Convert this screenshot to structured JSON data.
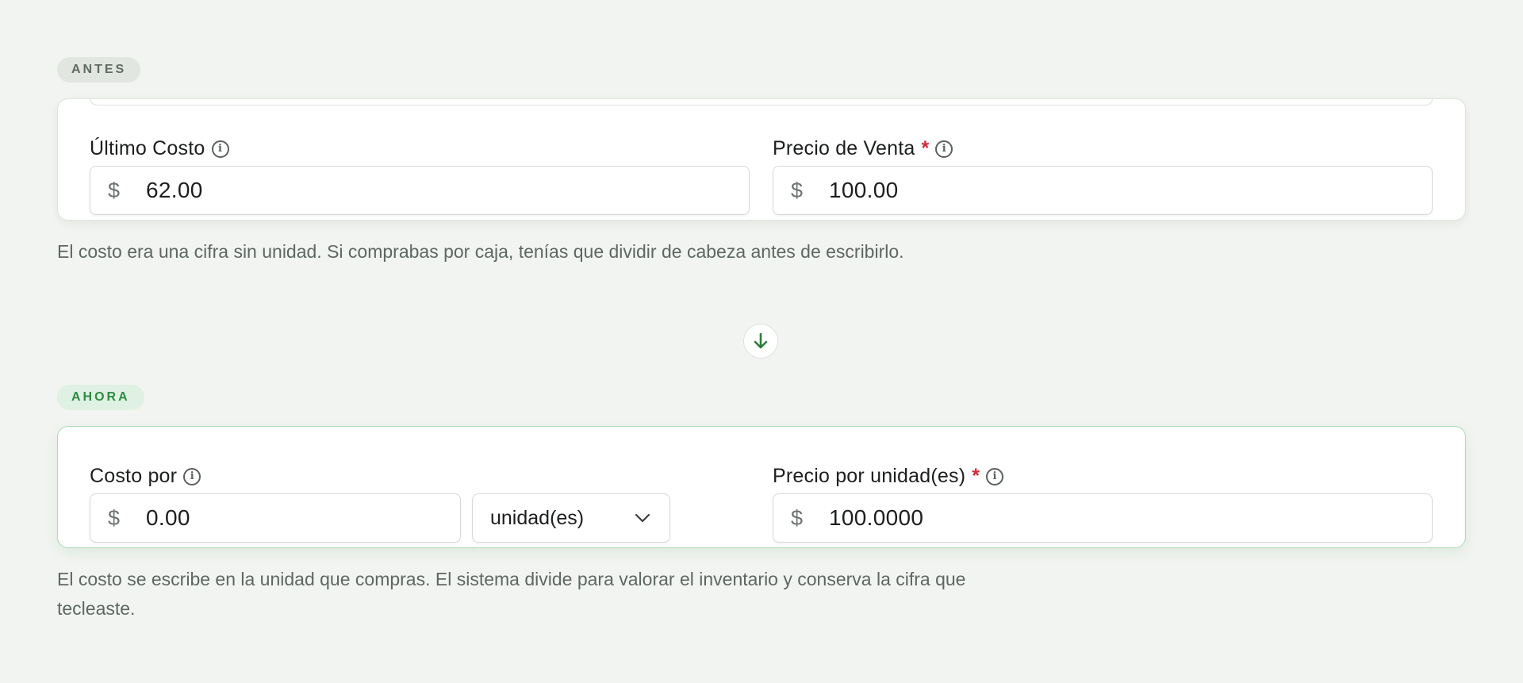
{
  "before": {
    "badge": "ANTES",
    "cost_label": "Último Costo",
    "cost_currency": "$",
    "cost_value": "62.00",
    "price_label": "Precio de Venta",
    "price_required_mark": "*",
    "price_currency": "$",
    "price_value": "100.00",
    "note": "El costo era una cifra sin unidad. Si comprabas por caja, tenías que dividir de cabeza antes de escribirlo."
  },
  "after": {
    "badge": "AHORA",
    "cost_label": "Costo por",
    "cost_currency": "$",
    "cost_value": "0.00",
    "unit_selected": "unidad(es)",
    "price_label": "Precio por unidad(es)",
    "price_required_mark": "*",
    "price_currency": "$",
    "price_value": "100.0000",
    "note": "El costo se escribe en la unidad que compras. El sistema divide para valorar el inventario y conserva la cifra que tecleaste."
  },
  "icons": {
    "info": "info-icon",
    "arrow": "arrow-down-icon",
    "chevron": "chevron-down-icon"
  },
  "colors": {
    "background": "#f2f4f1",
    "accent_green": "#2f8a43",
    "required_red": "#d6283a",
    "after_border": "#a9dcb4"
  }
}
